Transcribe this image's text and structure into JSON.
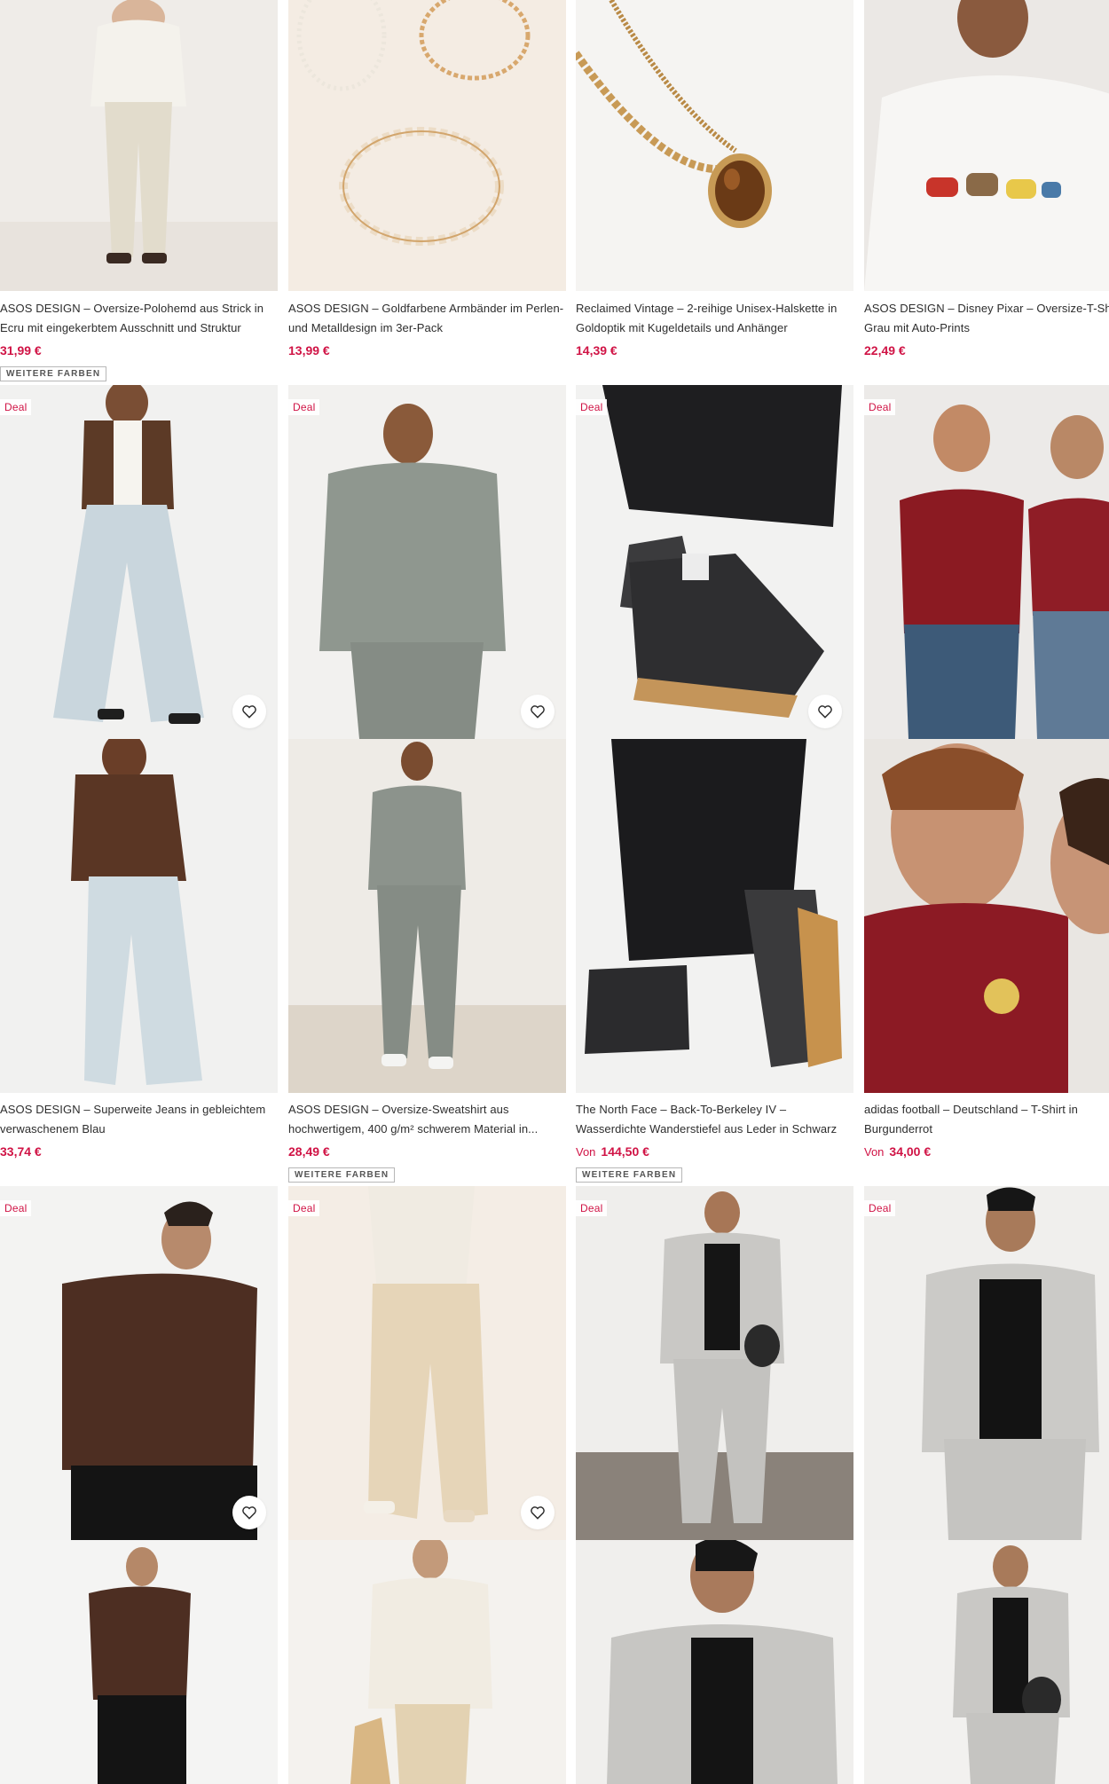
{
  "products": [
    {
      "title": "ASOS DESIGN – Oversize-Polohemd aus Strick in Ecru mit eingekerbtem Ausschnitt und Struktur",
      "price": "31,99 €",
      "price_prefix": "",
      "more_colors": "WEITERE FARBEN"
    },
    {
      "title": "ASOS DESIGN – Goldfarbene Armbänder im Perlen- und Metalldesign im 3er-Pack",
      "price": "13,99 €",
      "price_prefix": "",
      "more_colors": ""
    },
    {
      "title": "Reclaimed Vintage – 2-reihige Unisex-Halskette in Goldoptik mit Kugeldetails und Anhänger",
      "price": "14,39 €",
      "price_prefix": "",
      "more_colors": ""
    },
    {
      "title": "ASOS DESIGN – Disney Pixar – Oversize-T-Shirt in Grau mit Auto-Prints",
      "price": "22,49 €",
      "price_prefix": "",
      "more_colors": ""
    },
    {
      "title": "ASOS DESIGN – Superweite Jeans in gebleichtem verwaschenem Blau",
      "price": "33,74 €",
      "price_prefix": "",
      "more_colors": "",
      "deal": "Deal"
    },
    {
      "title": "ASOS DESIGN – Oversize-Sweatshirt aus hochwertigem, 400 g/m² schwerem Material in...",
      "price": "28,49 €",
      "price_prefix": "",
      "more_colors": "WEITERE FARBEN",
      "deal": "Deal"
    },
    {
      "title": "The North Face – Back-To-Berkeley IV – Wasserdichte Wanderstiefel aus Leder in Schwarz",
      "price": "144,50 €",
      "price_prefix": "Von",
      "more_colors": "WEITERE FARBEN",
      "deal": "Deal"
    },
    {
      "title": "adidas football – Deutschland – T-Shirt in Burgunderrot",
      "price": "34,00 €",
      "price_prefix": "Von",
      "more_colors": "",
      "deal": "Deal"
    },
    {
      "deal": "Deal"
    },
    {
      "deal": "Deal"
    },
    {
      "deal": "Deal"
    },
    {
      "deal": "Deal"
    }
  ],
  "colors": {
    "price": "#d01345",
    "deal": "#d01345",
    "text": "#2d2d2d"
  }
}
